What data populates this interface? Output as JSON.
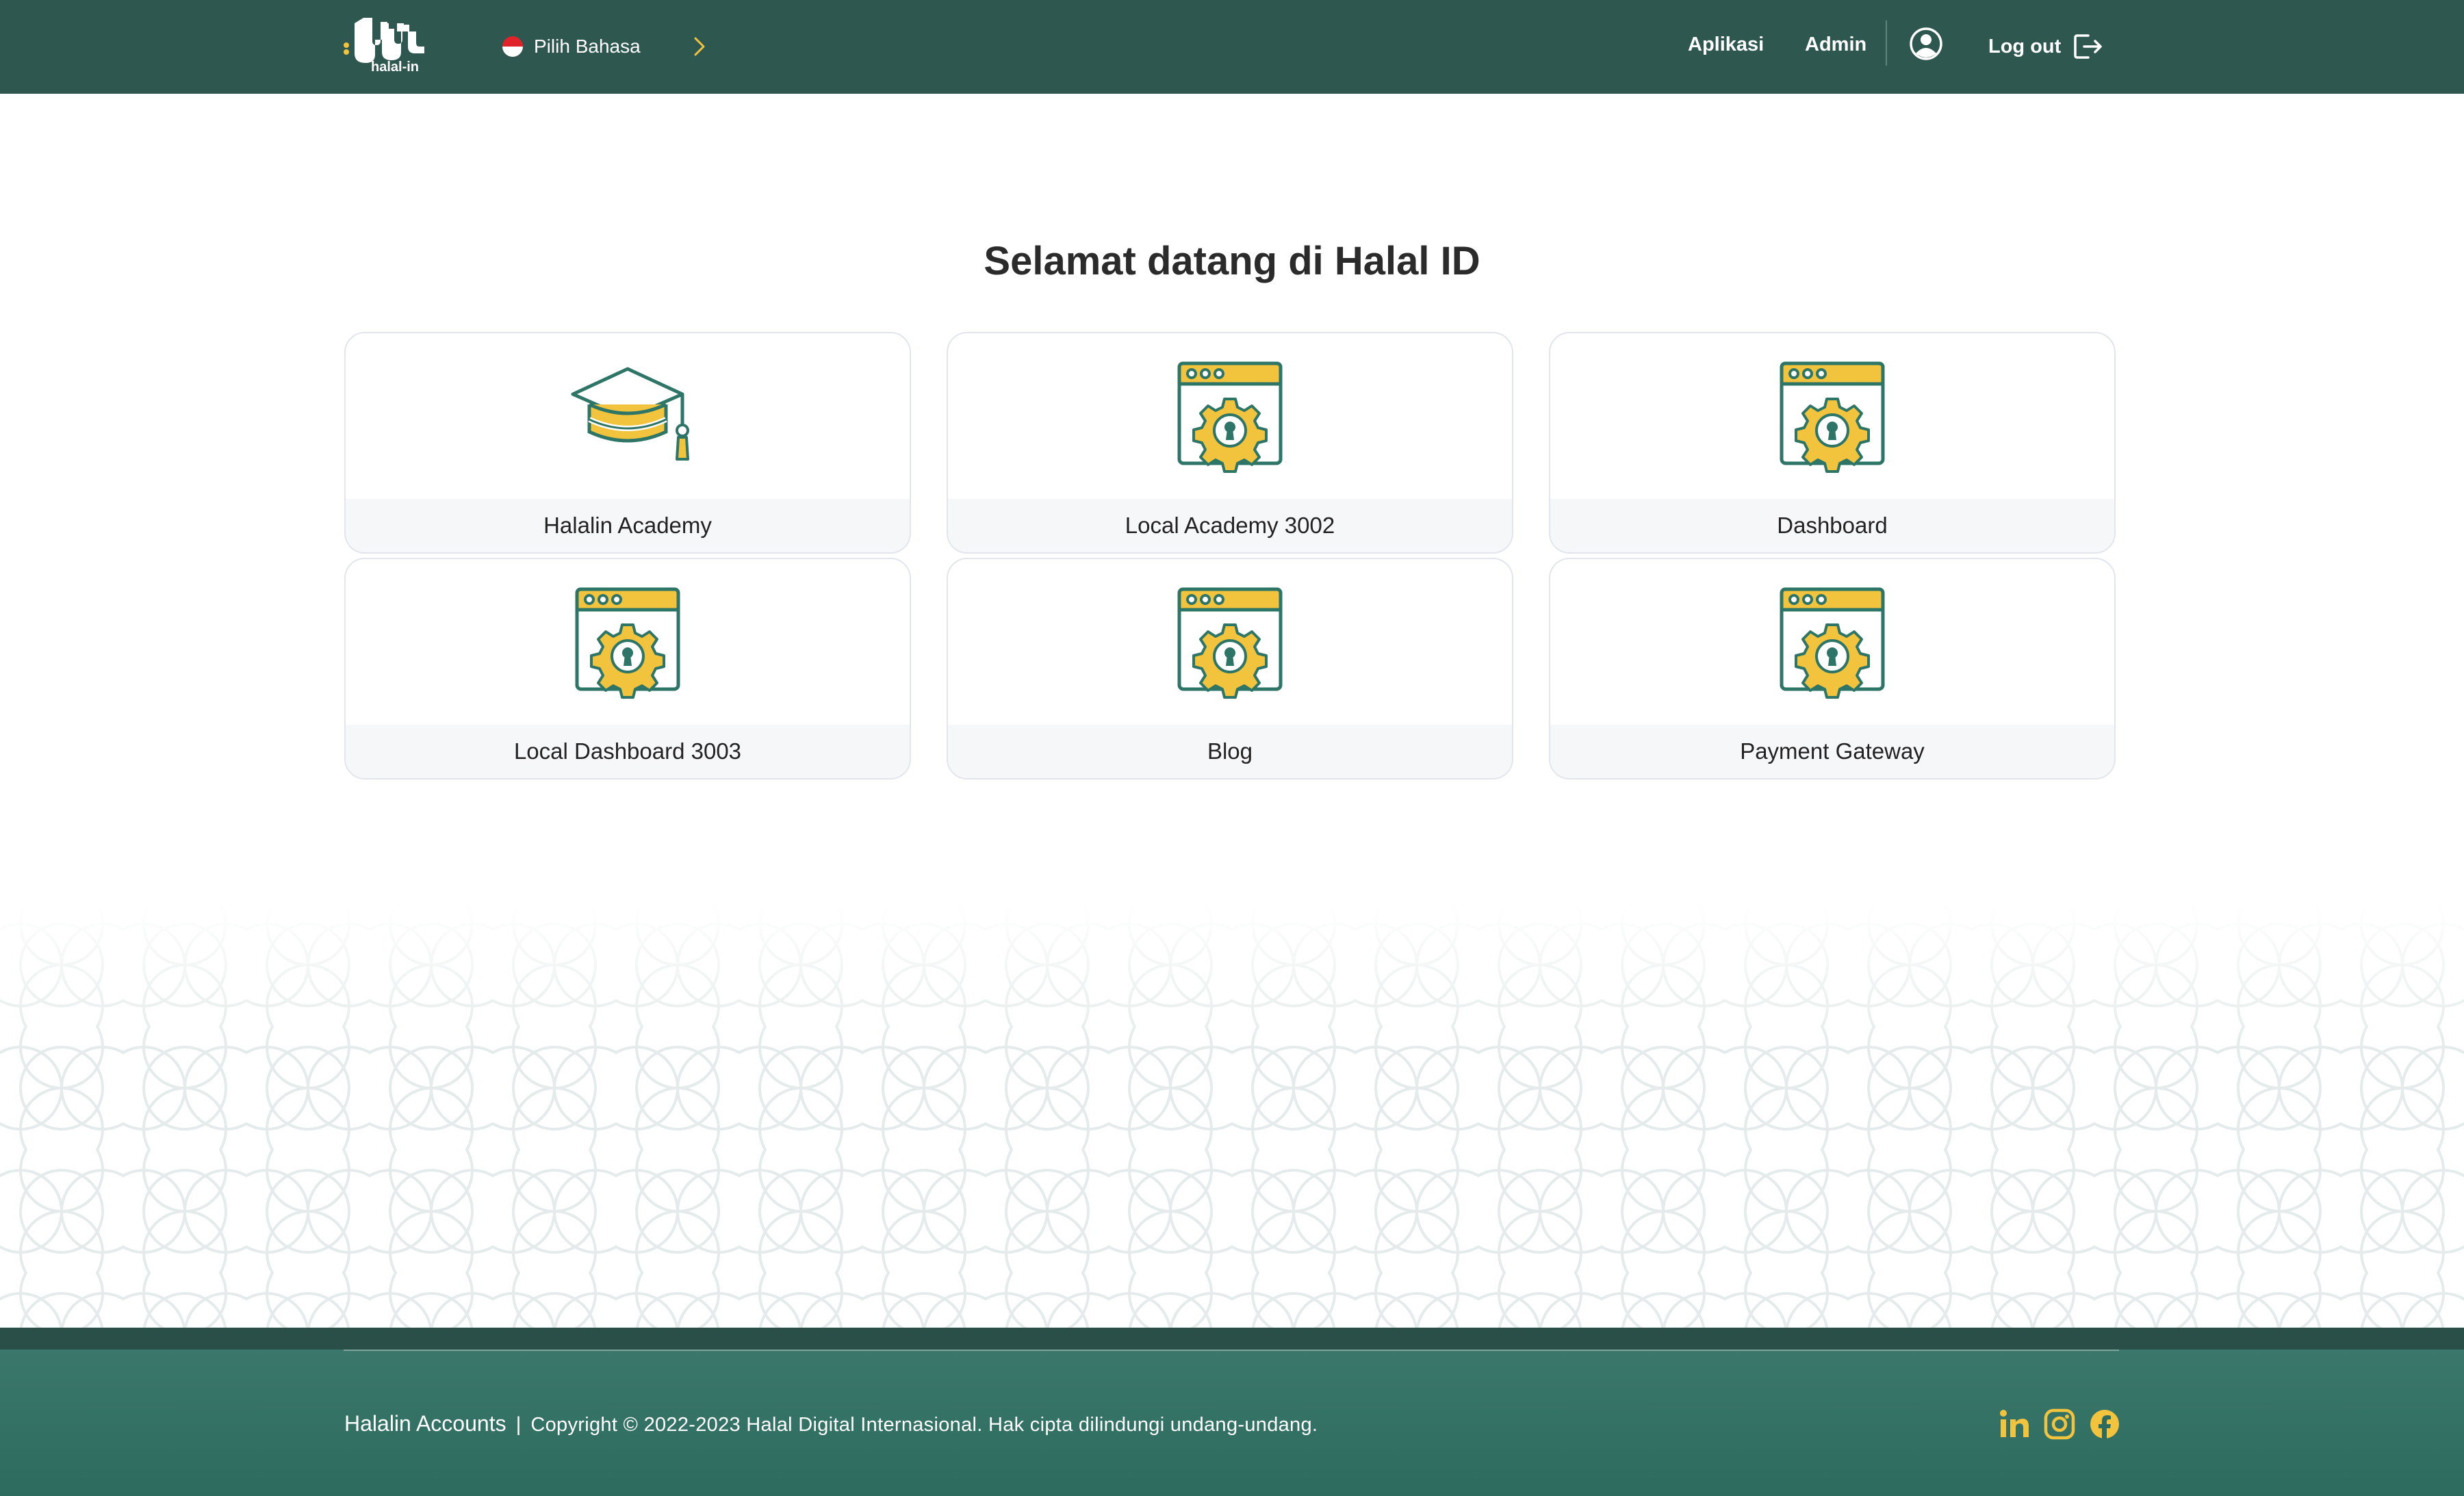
{
  "header": {
    "logo_text": "halal-in",
    "language_label": "Pilih Bahasa",
    "nav": {
      "apps": "Aplikasi",
      "admin": "Admin"
    },
    "logout_label": "Log out"
  },
  "main": {
    "title": "Selamat datang di Halal ID",
    "apps": [
      {
        "label": "Halalin Academy",
        "icon": "graduation-cap-icon"
      },
      {
        "label": "Local Academy 3002",
        "icon": "app-settings-icon"
      },
      {
        "label": "Dashboard",
        "icon": "app-settings-icon"
      },
      {
        "label": "Local Dashboard 3003",
        "icon": "app-settings-icon"
      },
      {
        "label": "Blog",
        "icon": "app-settings-icon"
      },
      {
        "label": "Payment Gateway",
        "icon": "app-settings-icon"
      }
    ]
  },
  "footer": {
    "brand": "Halalin Accounts",
    "separator": "|",
    "copyright": "Copyright © 2022-2023 Halal Digital Internasional. Hak cipta dilindungi undang-undang.",
    "social": [
      "linkedin-icon",
      "instagram-icon",
      "facebook-icon"
    ]
  },
  "colors": {
    "header_bg": "#2e574f",
    "accent_yellow": "#f2c33d",
    "icon_green": "#2d7566",
    "footer_bg": "#3b786b"
  }
}
